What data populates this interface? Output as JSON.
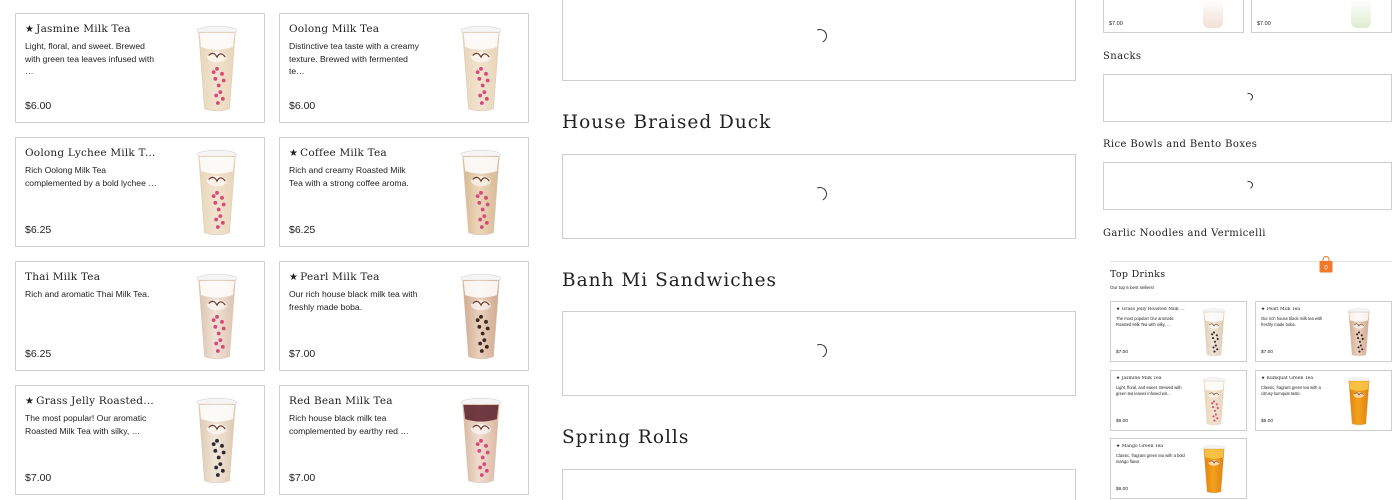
{
  "menu_items": [
    {
      "name": "Jasmine Milk Tea",
      "featured": true,
      "description": "Light, floral, and sweet. Brewed with green tea leaves infused with …",
      "price": "$6.00"
    },
    {
      "name": "Oolong Milk Tea",
      "featured": false,
      "description": "Distinctive tea taste with a creamy texture. Brewed with fermented te…",
      "price": "$6.00"
    },
    {
      "name": "Oolong Lychee Milk Tea",
      "featured": false,
      "description": "Rich Oolong Milk Tea complemented by a bold lychee …",
      "price": "$6.25"
    },
    {
      "name": "Coffee Milk Tea",
      "featured": true,
      "description": "Rich and creamy Roasted Milk Tea with a strong coffee aroma.",
      "price": "$6.25"
    },
    {
      "name": "Thai Milk Tea",
      "featured": false,
      "description": "Rich and aromatic Thai Milk Tea.",
      "price": "$6.25"
    },
    {
      "name": "Pearl Milk Tea",
      "featured": true,
      "description": "Our rich house black milk tea with freshly made boba.",
      "price": "$7.00"
    },
    {
      "name": "Grass Jelly Roasted Milk …",
      "featured": true,
      "description": "The most popular! Our aromatic Roasted Milk Tea with silky, …",
      "price": "$7.00"
    },
    {
      "name": "Red Bean Milk Tea",
      "featured": false,
      "description": "Rich house black milk tea complemented by earthy red …",
      "price": "$7.00"
    }
  ],
  "sections_main": [
    "House Braised Duck",
    "Banh Mi Sandwiches",
    "Spring Rolls"
  ],
  "sections_right": [
    "Snacks",
    "Rice Bowls and Bento Boxes",
    "Garlic Noodles and Vermicelli"
  ],
  "right_top_prices": [
    "$7.00",
    "$7.00"
  ],
  "cart": {
    "count": "0"
  },
  "top_drinks": {
    "title": "Top Drinks",
    "subtitle": "Our top 6 best sellers!",
    "items": [
      {
        "name": "Grass Jelly Roasted Milk …",
        "featured": true,
        "description": "The most popular! Our aromatic Roasted Milk Tea with silky, …",
        "price": "$7.00"
      },
      {
        "name": "Pearl Milk Tea",
        "featured": true,
        "description": "Our rich house black milk tea with freshly made boba.",
        "price": "$7.00"
      },
      {
        "name": "Jasmine Milk Tea",
        "featured": true,
        "description": "Light, floral, and sweet. Brewed with green tea leaves infused wit…",
        "price": "$6.00"
      },
      {
        "name": "Kumquat Green Tea",
        "featured": true,
        "description": "Classic, fragrant green tea with a citrusy kumquat taste.",
        "price": "$6.00"
      },
      {
        "name": "Mango Green Tea",
        "featured": true,
        "description": "Classic, fragrant green tea with a bold mango flavor.",
        "price": "$6.00"
      }
    ]
  },
  "colors": {
    "border": "#cfcfcf",
    "cart_badge": "#f07a2a",
    "milk_tea": "#f1e3cf",
    "green_tea": "#f2a21d",
    "boba": "#d64b7a"
  },
  "icons": {
    "featured": "star-icon",
    "cart": "shopping-bag-icon",
    "loading": "spinner-icon"
  },
  "labels": {
    "featured_star": "★"
  }
}
